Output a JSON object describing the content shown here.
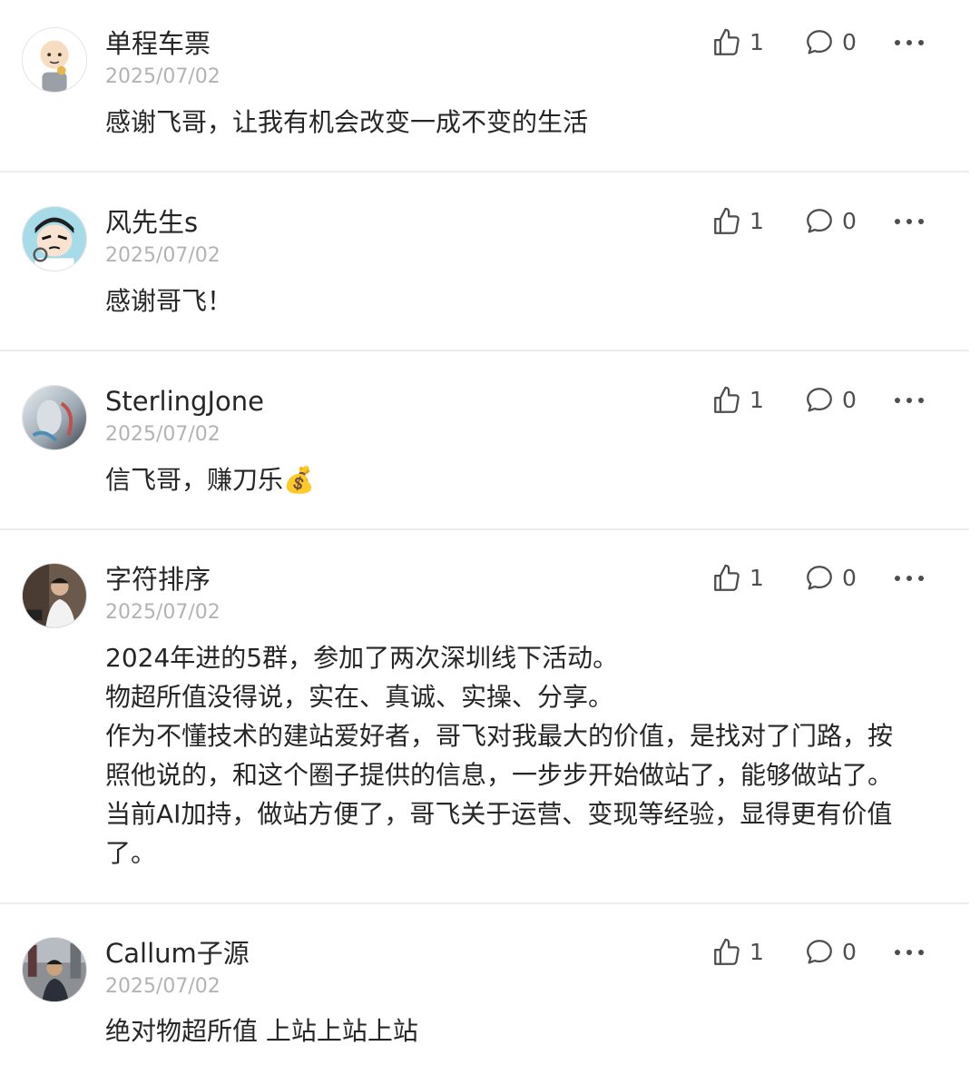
{
  "comments": [
    {
      "username": "单程车票",
      "date": "2025/07/02",
      "content": [
        "感谢飞哥，让我有机会改变一成不变的生活"
      ],
      "likes": "1",
      "replies": "0"
    },
    {
      "username": "风先生s",
      "date": "2025/07/02",
      "content": [
        "感谢哥飞！"
      ],
      "likes": "1",
      "replies": "0"
    },
    {
      "username": "SterlingJone",
      "date": "2025/07/02",
      "content": [
        "信飞哥，赚刀乐💰"
      ],
      "likes": "1",
      "replies": "0"
    },
    {
      "username": "字符排序",
      "date": "2025/07/02",
      "content": [
        "2024年进的5群，参加了两次深圳线下活动。",
        "物超所值没得说，实在、真诚、实操、分享。",
        "作为不懂技术的建站爱好者，哥飞对我最大的价值，是找对了门路，按",
        "照他说的，和这个圈子提供的信息，一步步开始做站了，能够做站了。",
        "当前AI加持，做站方便了，哥飞关于运营、变现等经验，显得更有价值",
        "了。"
      ],
      "likes": "1",
      "replies": "0"
    },
    {
      "username": "Callum子源",
      "date": "2025/07/02",
      "content": [
        "绝对物超所值 上站上站上站"
      ],
      "likes": "1",
      "replies": "0"
    }
  ],
  "icons": {
    "like": "thumbs-up-icon",
    "reply": "comment-bubble-icon",
    "more": "more-dots-icon"
  },
  "colors": {
    "text": "#262626",
    "date": "#b3b3b3",
    "icon": "#4d4d4d",
    "divider": "#ececec"
  }
}
